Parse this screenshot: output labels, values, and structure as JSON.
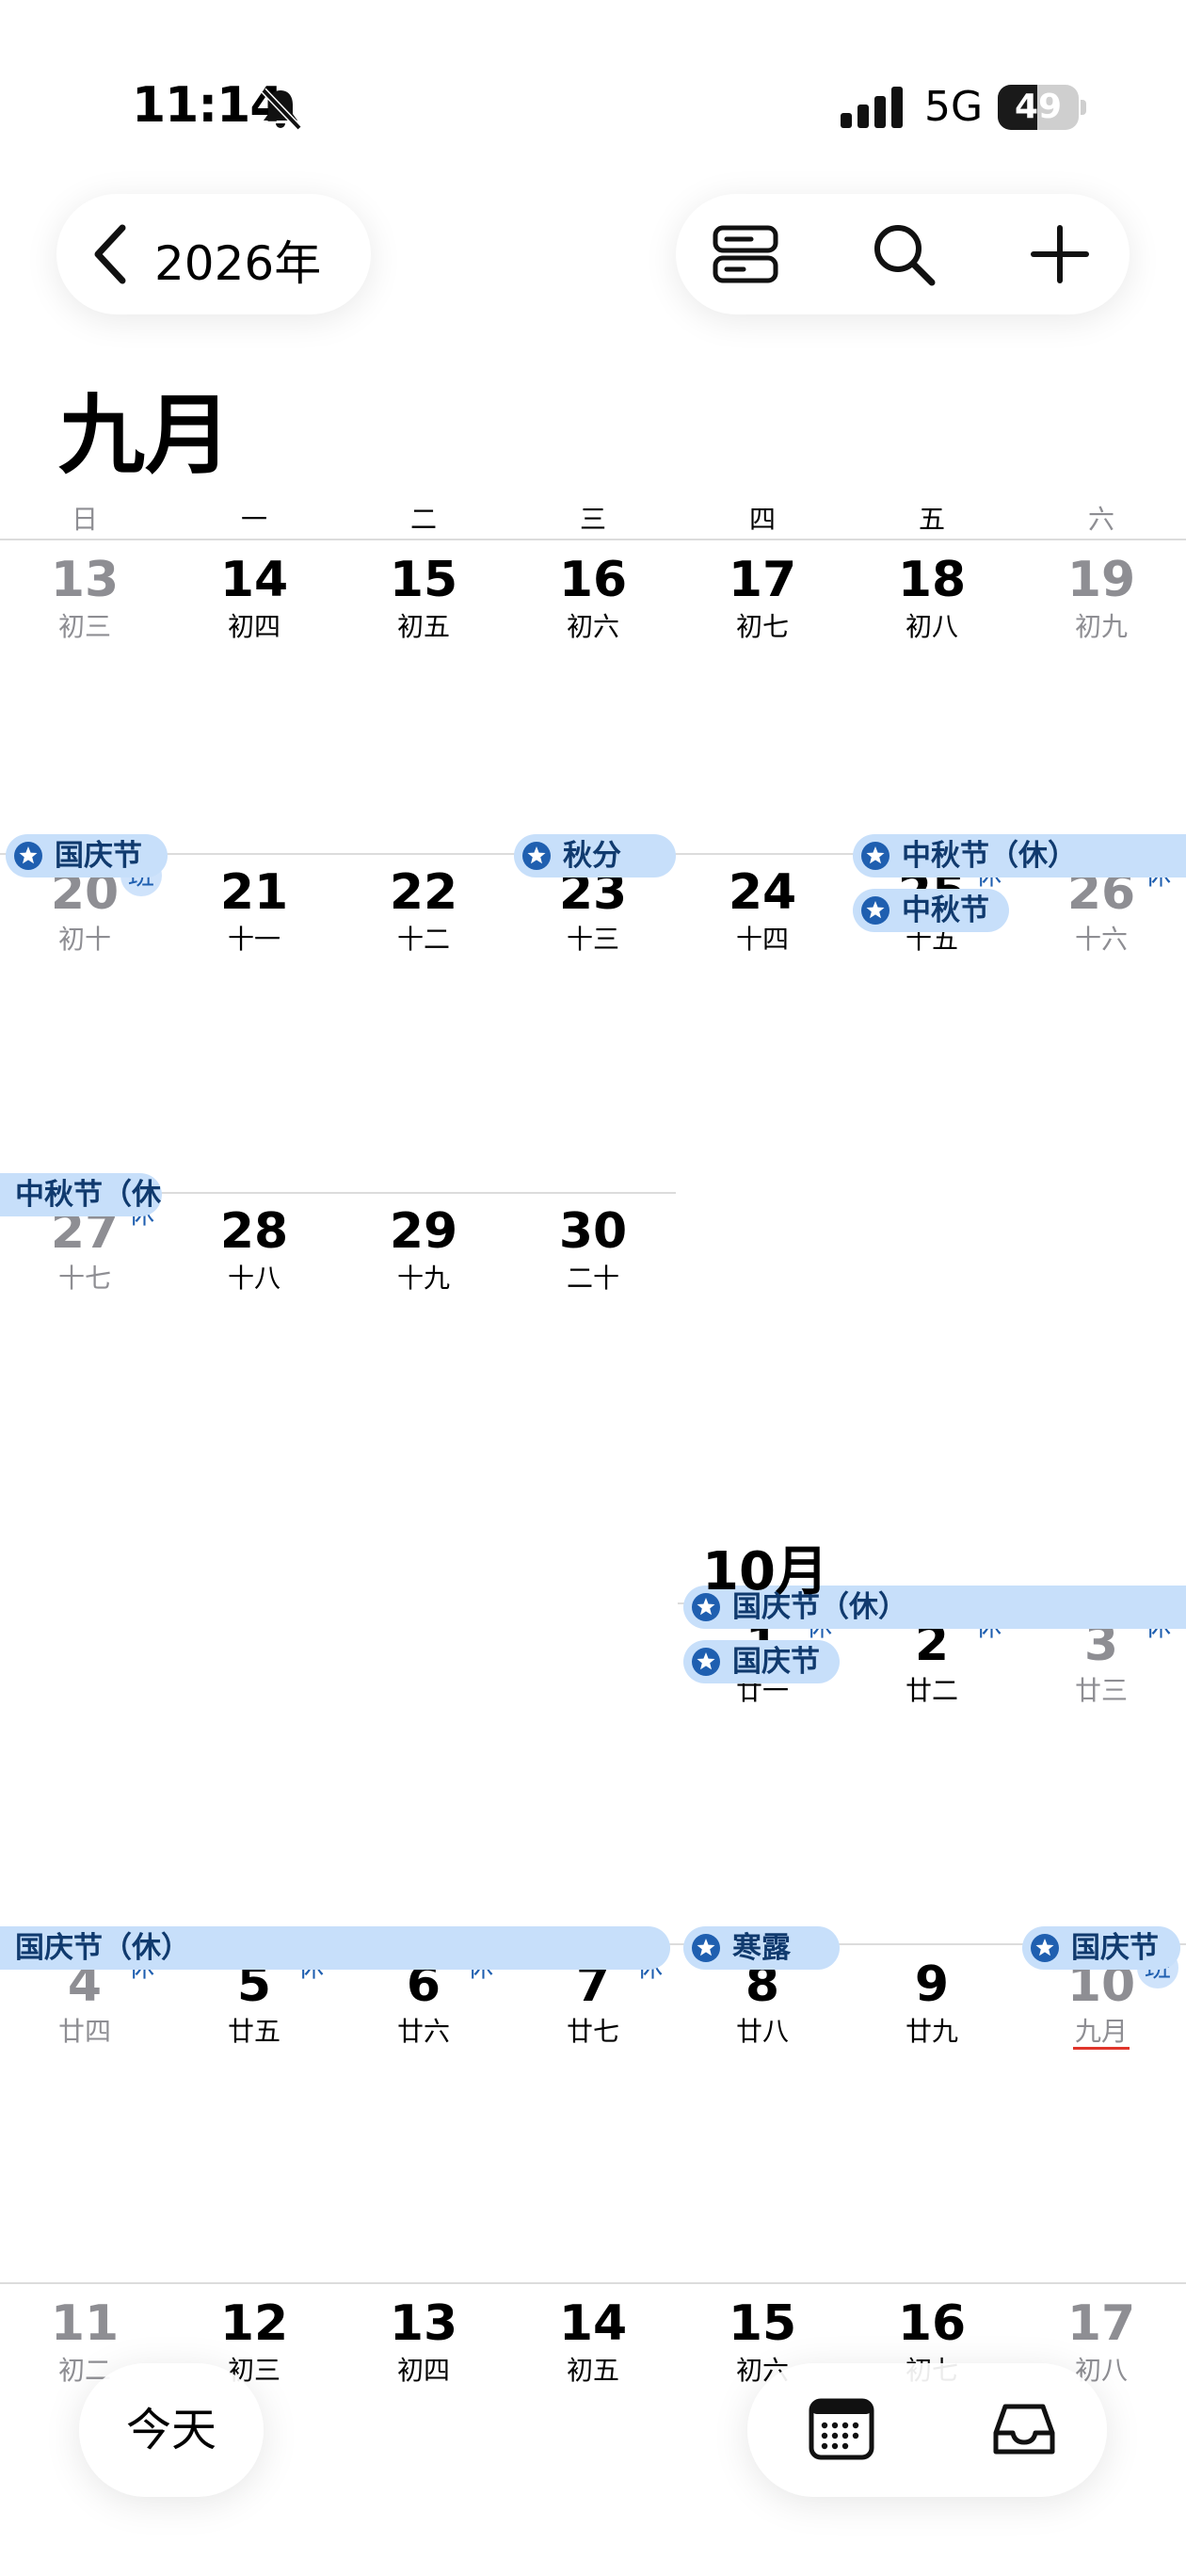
{
  "status_bar": {
    "time": "11:14",
    "network": "5G",
    "battery_text": "49",
    "battery_percent": 49
  },
  "toolbar": {
    "year_label": "2026年"
  },
  "icons": {
    "back": "chevron-left-icon",
    "bell": "bell-slash-icon",
    "list": "list-view-icon",
    "search": "search-icon",
    "add": "plus-icon",
    "calendar": "calendar-icon",
    "inbox": "inbox-icon",
    "star": "star-icon"
  },
  "month_title": "九月",
  "october_title": "10月",
  "weekdays": [
    "日",
    "一",
    "二",
    "三",
    "四",
    "五",
    "六"
  ],
  "weeks": [
    {
      "days": [
        {
          "num": "13",
          "lunar": "初三"
        },
        {
          "num": "14",
          "lunar": "初四"
        },
        {
          "num": "15",
          "lunar": "初五"
        },
        {
          "num": "16",
          "lunar": "初六"
        },
        {
          "num": "17",
          "lunar": "初七"
        },
        {
          "num": "18",
          "lunar": "初八"
        },
        {
          "num": "19",
          "lunar": "初九"
        }
      ]
    },
    {
      "days": [
        {
          "num": "20",
          "lunar": "初十",
          "tag": "班"
        },
        {
          "num": "21",
          "lunar": "十一"
        },
        {
          "num": "22",
          "lunar": "十二"
        },
        {
          "num": "23",
          "lunar": "十三"
        },
        {
          "num": "24",
          "lunar": "十四"
        },
        {
          "num": "25",
          "lunar": "十五",
          "tag": "休"
        },
        {
          "num": "26",
          "lunar": "十六",
          "tag": "休"
        }
      ],
      "events": [
        {
          "label": "国庆节",
          "icon": true
        },
        {
          "label": "秋分",
          "icon": true
        },
        {
          "label": "中秋节（休）",
          "icon": true
        },
        {
          "label": "中秋节",
          "icon": true
        }
      ]
    },
    {
      "days": [
        {
          "num": "27",
          "lunar": "十七",
          "tag": "休"
        },
        {
          "num": "28",
          "lunar": "十八"
        },
        {
          "num": "29",
          "lunar": "十九"
        },
        {
          "num": "30",
          "lunar": "二十"
        }
      ],
      "events": [
        {
          "label": "中秋节（休）",
          "icon": false
        }
      ]
    },
    {
      "days": [
        {
          "num": "1",
          "lunar": "廿一",
          "tag": "休"
        },
        {
          "num": "2",
          "lunar": "廿二",
          "tag": "休"
        },
        {
          "num": "3",
          "lunar": "廿三",
          "tag": "休"
        }
      ],
      "events": [
        {
          "label": "国庆节（休）",
          "icon": true
        },
        {
          "label": "国庆节",
          "icon": true
        }
      ]
    },
    {
      "days": [
        {
          "num": "4",
          "lunar": "廿四",
          "tag": "休"
        },
        {
          "num": "5",
          "lunar": "廿五",
          "tag": "休"
        },
        {
          "num": "6",
          "lunar": "廿六",
          "tag": "休"
        },
        {
          "num": "7",
          "lunar": "廿七",
          "tag": "休"
        },
        {
          "num": "8",
          "lunar": "廿八"
        },
        {
          "num": "9",
          "lunar": "廿九"
        },
        {
          "num": "10",
          "lunar": "九月",
          "tag": "班",
          "today": true
        }
      ],
      "events": [
        {
          "label": "国庆节（休）",
          "icon": false
        },
        {
          "label": "寒露",
          "icon": true
        },
        {
          "label": "国庆节",
          "icon": true
        }
      ]
    },
    {
      "days": [
        {
          "num": "11",
          "lunar": "初二"
        },
        {
          "num": "12",
          "lunar": "初三"
        },
        {
          "num": "13",
          "lunar": "初四"
        },
        {
          "num": "14",
          "lunar": "初五"
        },
        {
          "num": "15",
          "lunar": "初六"
        },
        {
          "num": "16",
          "lunar": "初七"
        },
        {
          "num": "17",
          "lunar": "初八"
        }
      ]
    }
  ],
  "bottom_bar": {
    "today_label": "今天"
  },
  "colors": {
    "event_bg": "#c7dffa",
    "event_text": "#103a6e",
    "tag_text": "#1f5fb0",
    "today_underline": "#e0352b"
  }
}
